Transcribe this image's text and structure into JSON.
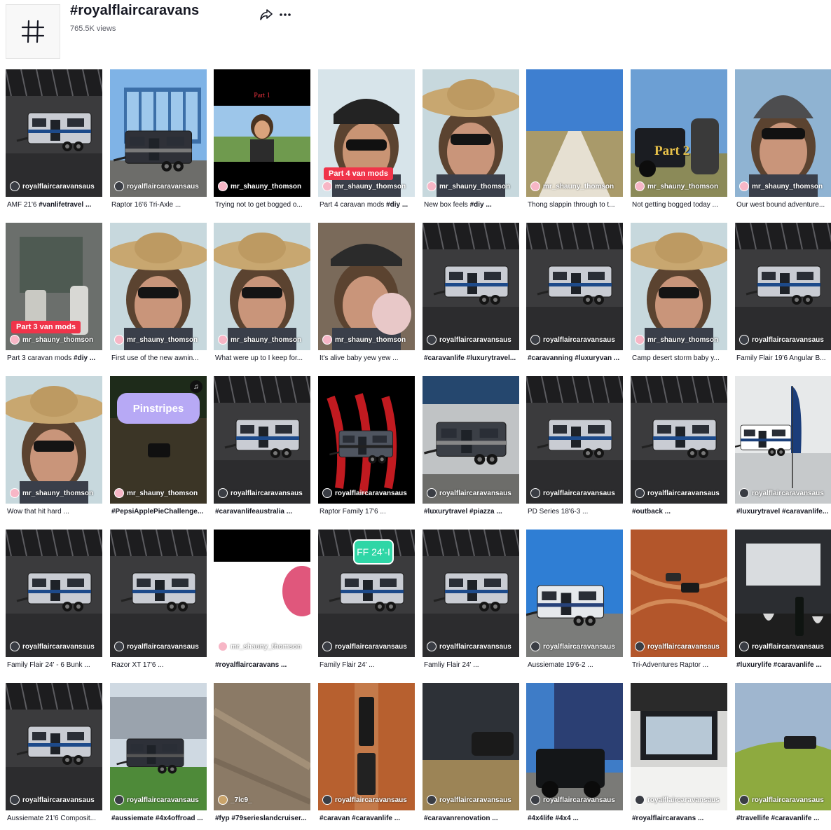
{
  "hashtag": {
    "title": "#royalflaircaravans",
    "views": "765.5K views",
    "icons": {
      "hash": "hash-icon",
      "share": "share-icon",
      "more": "more-icon"
    }
  },
  "videos": [
    {
      "author": "royalflaircaravansaus",
      "avatar": "dark",
      "scene": "warehouse-caravan",
      "caption_bold": "",
      "caption": "AMF 21'6 ",
      "caption_tags": "#vanlifetravel ...",
      "overlay": ""
    },
    {
      "author": "royalflaircaravansaus",
      "avatar": "dark",
      "scene": "building-caravan",
      "caption_bold": "",
      "caption": "Raptor 16'6 Tri-Axle ...",
      "caption_tags": "",
      "overlay": ""
    },
    {
      "author": "mr_shauny_thomson",
      "avatar": "pink",
      "scene": "black-top-face",
      "caption_bold": "",
      "caption": "Trying not to get bogged o...",
      "caption_tags": "",
      "overlay": "Part 1"
    },
    {
      "author": "mr_shauny_thomson",
      "avatar": "pink",
      "scene": "face-sunglasses",
      "caption_bold": "",
      "caption": "Part 4 caravan mods ",
      "caption_tags": "#diy ...",
      "overlay": "Part 4 van mods"
    },
    {
      "author": "mr_shauny_thomson",
      "avatar": "pink",
      "scene": "face-hat",
      "caption_bold": "",
      "caption": "New box feels ",
      "caption_tags": "#diy ...",
      "overlay": ""
    },
    {
      "author": "mr_shauny_thomson",
      "avatar": "pink",
      "scene": "dirt-road",
      "caption_bold": "",
      "caption": "Thong slappin through to t...",
      "caption_tags": "",
      "overlay": ""
    },
    {
      "author": "mr_shauny_thomson",
      "avatar": "pink",
      "scene": "car-outback",
      "caption_bold": "",
      "caption": "Not getting bogged today ...",
      "caption_tags": "",
      "overlay": "Part 2"
    },
    {
      "author": "mr_shauny_thomson",
      "avatar": "pink",
      "scene": "face-beanie",
      "caption_bold": "",
      "caption": "Our west bound adventure...",
      "caption_tags": "",
      "overlay": ""
    },
    {
      "author": "mr_shauny_thomson",
      "avatar": "pink",
      "scene": "van-interior",
      "caption_bold": "",
      "caption": "Part 3 caravan mods ",
      "caption_tags": "#diy ...",
      "overlay": "Part 3 van mods"
    },
    {
      "author": "mr_shauny_thomson",
      "avatar": "pink",
      "scene": "face-hat",
      "caption_bold": "",
      "caption": "First use of the new awnin...",
      "caption_tags": "",
      "overlay": ""
    },
    {
      "author": "mr_shauny_thomson",
      "avatar": "pink",
      "scene": "face-hat",
      "caption_bold": "",
      "caption": "What were up to I keep for...",
      "caption_tags": "",
      "overlay": ""
    },
    {
      "author": "mr_shauny_thomson",
      "avatar": "pink",
      "scene": "face-plain",
      "caption_bold": "",
      "caption": "It's alive baby yew yew ...",
      "caption_tags": "",
      "overlay": ""
    },
    {
      "author": "royalflaircaravansaus",
      "avatar": "dark",
      "scene": "warehouse-caravan",
      "caption_bold": "#caravanlife #luxurytravel...",
      "caption": "",
      "caption_tags": "",
      "overlay": ""
    },
    {
      "author": "royalflaircaravansaus",
      "avatar": "dark",
      "scene": "warehouse-caravan",
      "caption_bold": "#caravanning #luxuryvan ...",
      "caption": "",
      "caption_tags": "",
      "overlay": ""
    },
    {
      "author": "mr_shauny_thomson",
      "avatar": "pink",
      "scene": "face-hat",
      "caption_bold": "",
      "caption": "Camp desert storm baby y...",
      "caption_tags": "",
      "overlay": ""
    },
    {
      "author": "royalflaircaravansaus",
      "avatar": "dark",
      "scene": "warehouse-caravan",
      "caption_bold": "",
      "caption": "Family Flair 19'6 Angular B...",
      "caption_tags": "",
      "overlay": ""
    },
    {
      "author": "mr_shauny_thomson",
      "avatar": "pink",
      "scene": "face-hat",
      "caption_bold": "",
      "caption": "Wow that hit hard ...",
      "caption_tags": "",
      "overlay": ""
    },
    {
      "author": "mr_shauny_thomson",
      "avatar": "pink",
      "scene": "bush",
      "caption_bold": "#PepsiApplePieChallenge...",
      "caption": "",
      "caption_tags": "",
      "overlay": "Pinstripes"
    },
    {
      "author": "royalflaircaravansaus",
      "avatar": "dark",
      "scene": "warehouse-caravan",
      "caption_bold": "#caravanlifeaustralia ...",
      "caption": "",
      "caption_tags": "",
      "overlay": ""
    },
    {
      "author": "royalflaircaravansaus",
      "avatar": "dark",
      "scene": "claw",
      "caption_bold": "",
      "caption": "Raptor Family 17'6 ...",
      "caption_tags": "",
      "overlay": ""
    },
    {
      "author": "royalflaircaravansaus",
      "avatar": "dark",
      "scene": "factory",
      "caption_bold": "#luxurytravel #piazza ...",
      "caption": "",
      "caption_tags": "",
      "overlay": ""
    },
    {
      "author": "royalflaircaravansaus",
      "avatar": "dark",
      "scene": "warehouse-caravan",
      "caption_bold": "",
      "caption": "PD Series 18'6-3 ...",
      "caption_tags": "",
      "overlay": ""
    },
    {
      "author": "royalflaircaravansaus",
      "avatar": "dark",
      "scene": "warehouse-caravan",
      "caption_bold": "#outback ...",
      "caption": "",
      "caption_tags": "",
      "overlay": ""
    },
    {
      "author": "royalflaircaravansaus",
      "avatar": "dark",
      "scene": "showroom",
      "caption_bold": "#luxurytravel #caravanlife...",
      "caption": "",
      "caption_tags": "",
      "overlay": ""
    },
    {
      "author": "royalflaircaravansaus",
      "avatar": "dark",
      "scene": "warehouse-caravan",
      "caption_bold": "",
      "caption": "Family Flair 24' - 6 Bunk ...",
      "caption_tags": "",
      "overlay": ""
    },
    {
      "author": "royalflaircaravansaus",
      "avatar": "dark",
      "scene": "warehouse-caravan",
      "caption_bold": "",
      "caption": "Razor XT 17'6 ...",
      "caption_tags": "",
      "overlay": ""
    },
    {
      "author": "mr_shauny_thomson",
      "avatar": "pink",
      "scene": "pink-glow",
      "caption_bold": "#royalflaircaravans ...",
      "caption": "",
      "caption_tags": "",
      "overlay": ""
    },
    {
      "author": "royalflaircaravansaus",
      "avatar": "dark",
      "scene": "warehouse-caravan",
      "caption_bold": "",
      "caption": "Family Flair 24' ...",
      "caption_tags": "",
      "overlay": "FF 24'-I"
    },
    {
      "author": "royalflaircaravansaus",
      "avatar": "dark",
      "scene": "warehouse-caravan",
      "caption_bold": "",
      "caption": "Famliy Flair 24' ...",
      "caption_tags": "",
      "overlay": ""
    },
    {
      "author": "royalflaircaravansaus",
      "avatar": "dark",
      "scene": "sky-caravan",
      "caption_bold": "",
      "caption": "Aussiemate 19'6-2 ...",
      "caption_tags": "",
      "overlay": ""
    },
    {
      "author": "royalflaircaravansaus",
      "avatar": "dark",
      "scene": "red-dirt",
      "caption_bold": "",
      "caption": "Tri-Adventures Raptor ...",
      "caption_tags": "",
      "overlay": ""
    },
    {
      "author": "royalflaircaravansaus",
      "avatar": "dark",
      "scene": "interior-wine",
      "caption_bold": "#luxurylife #caravanlife ...",
      "caption": "",
      "caption_tags": "",
      "overlay": ""
    },
    {
      "author": "royalflaircaravansaus",
      "avatar": "dark",
      "scene": "warehouse-caravan",
      "caption_bold": "",
      "caption": "Aussiemate 21'6 Composit...",
      "caption_tags": "",
      "overlay": ""
    },
    {
      "author": "royalflaircaravansaus",
      "avatar": "dark",
      "scene": "expo",
      "caption_bold": "#aussiemate #4x4offroad ...",
      "caption": "",
      "caption_tags": "",
      "overlay": ""
    },
    {
      "author": "_7lc9_",
      "avatar": "tan",
      "scene": "aerial-sand",
      "caption_bold": "#fyp #79serieslandcruiser...",
      "caption": "",
      "caption_tags": "",
      "overlay": ""
    },
    {
      "author": "royalflaircaravansaus",
      "avatar": "dark",
      "scene": "aerial-road",
      "caption_bold": "#caravan #caravanlife ...",
      "caption": "",
      "caption_tags": "",
      "overlay": ""
    },
    {
      "author": "royalflaircaravansaus",
      "avatar": "dark",
      "scene": "offroad",
      "caption_bold": "#caravanrenovation ...",
      "caption": "",
      "caption_tags": "",
      "overlay": ""
    },
    {
      "author": "royalflaircaravansaus",
      "avatar": "dark",
      "scene": "truck-building",
      "caption_bold": "#4x4life #4x4 ...",
      "caption": "",
      "caption_tags": "",
      "overlay": ""
    },
    {
      "author": "royalflaircaravansaus",
      "avatar": "dark",
      "scene": "interior-window",
      "caption_bold": "#royalflaircaravans ...",
      "caption": "",
      "caption_tags": "",
      "overlay": ""
    },
    {
      "author": "royalflaircaravansaus",
      "avatar": "dark",
      "scene": "green-field",
      "caption_bold": "#travellife #caravanlife ...",
      "caption": "",
      "caption_tags": "",
      "overlay": ""
    }
  ]
}
